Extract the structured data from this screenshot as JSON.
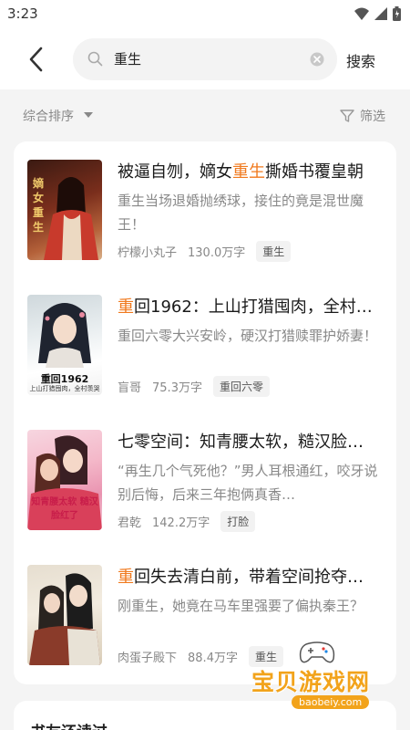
{
  "status": {
    "time": "3:23"
  },
  "search": {
    "query": "重生",
    "button_label": "搜索"
  },
  "sort": {
    "label": "综合排序",
    "filter_label": "筛选"
  },
  "books": [
    {
      "title_pre": "被逼自刎，嫡女",
      "title_hl": "重生",
      "title_post": "撕婚书覆皇朝",
      "desc": "重生当场退婚抛绣球，接住的竟是混世魔王！",
      "author": "柠檬小丸子",
      "words": "130.0万字",
      "tag": "重生",
      "cover_text": "",
      "cover_sub": ""
    },
    {
      "title_pre": "",
      "title_hl": "重",
      "title_post": "回1962：上山打猎囤肉，全村…",
      "desc": "重回六零大兴安岭，硬汉打猎赎罪护娇妻！",
      "author": "盲哥",
      "words": "75.3万字",
      "tag": "重回六零",
      "cover_text": "重回1962",
      "cover_sub": "上山打猎囤肉，全村羡哭"
    },
    {
      "title_pre": "七零空间：知青腰太软，糙汉脸…",
      "title_hl": "",
      "title_post": "",
      "desc": "“再生几个气死他？”男人耳根通红，咬牙说别后悔，后来三年抱俩真香…",
      "author": "君乾",
      "words": "142.2万字",
      "tag": "打脸",
      "cover_text": "知青腰太软 糙汉脸红了",
      "cover_sub": ""
    },
    {
      "title_pre": "",
      "title_hl": "重",
      "title_post": "回失去清白前，带着空间抢夺…",
      "desc": "刚重生，她竟在马车里强要了偏执秦王？",
      "author": "肉蛋子殿下",
      "words": "88.4万字",
      "tag": "重生",
      "cover_text": "",
      "cover_sub": ""
    }
  ],
  "bottom": {
    "title": "书友还读过"
  },
  "watermark": {
    "text": "宝贝游戏网",
    "url": "baobeiy.com"
  },
  "colors": {
    "highlight": "#f07a1f",
    "background": "#f4f4f4",
    "watermark": "#f2a31b"
  },
  "icons": [
    "wifi-icon",
    "signal-icon",
    "battery-icon",
    "back-arrow-icon",
    "search-icon",
    "clear-icon",
    "sort-caret-icon",
    "filter-icon",
    "gamepad-icon"
  ]
}
